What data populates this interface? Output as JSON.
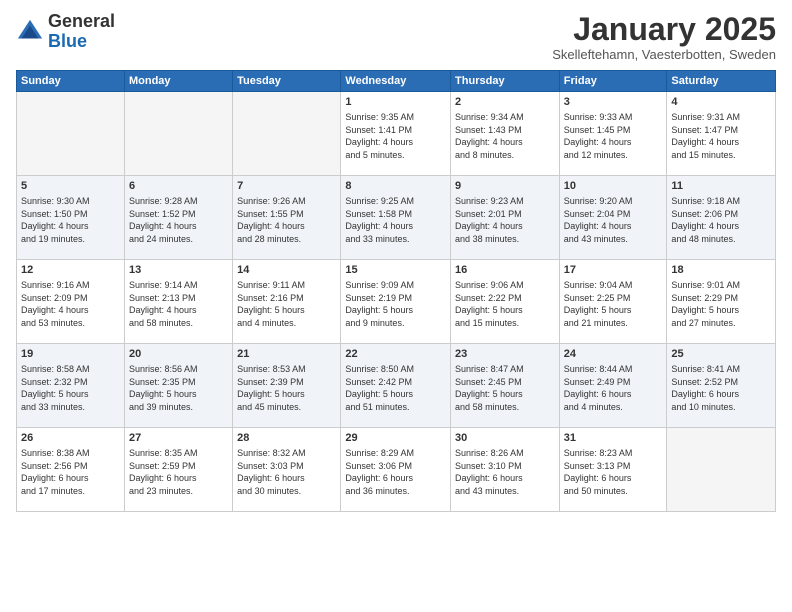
{
  "logo": {
    "general": "General",
    "blue": "Blue"
  },
  "header": {
    "title": "January 2025",
    "location": "Skelleftehamn, Vaesterbotten, Sweden"
  },
  "weekdays": [
    "Sunday",
    "Monday",
    "Tuesday",
    "Wednesday",
    "Thursday",
    "Friday",
    "Saturday"
  ],
  "weeks": [
    [
      {
        "day": "",
        "info": ""
      },
      {
        "day": "",
        "info": ""
      },
      {
        "day": "",
        "info": ""
      },
      {
        "day": "1",
        "info": "Sunrise: 9:35 AM\nSunset: 1:41 PM\nDaylight: 4 hours\nand 5 minutes."
      },
      {
        "day": "2",
        "info": "Sunrise: 9:34 AM\nSunset: 1:43 PM\nDaylight: 4 hours\nand 8 minutes."
      },
      {
        "day": "3",
        "info": "Sunrise: 9:33 AM\nSunset: 1:45 PM\nDaylight: 4 hours\nand 12 minutes."
      },
      {
        "day": "4",
        "info": "Sunrise: 9:31 AM\nSunset: 1:47 PM\nDaylight: 4 hours\nand 15 minutes."
      }
    ],
    [
      {
        "day": "5",
        "info": "Sunrise: 9:30 AM\nSunset: 1:50 PM\nDaylight: 4 hours\nand 19 minutes."
      },
      {
        "day": "6",
        "info": "Sunrise: 9:28 AM\nSunset: 1:52 PM\nDaylight: 4 hours\nand 24 minutes."
      },
      {
        "day": "7",
        "info": "Sunrise: 9:26 AM\nSunset: 1:55 PM\nDaylight: 4 hours\nand 28 minutes."
      },
      {
        "day": "8",
        "info": "Sunrise: 9:25 AM\nSunset: 1:58 PM\nDaylight: 4 hours\nand 33 minutes."
      },
      {
        "day": "9",
        "info": "Sunrise: 9:23 AM\nSunset: 2:01 PM\nDaylight: 4 hours\nand 38 minutes."
      },
      {
        "day": "10",
        "info": "Sunrise: 9:20 AM\nSunset: 2:04 PM\nDaylight: 4 hours\nand 43 minutes."
      },
      {
        "day": "11",
        "info": "Sunrise: 9:18 AM\nSunset: 2:06 PM\nDaylight: 4 hours\nand 48 minutes."
      }
    ],
    [
      {
        "day": "12",
        "info": "Sunrise: 9:16 AM\nSunset: 2:09 PM\nDaylight: 4 hours\nand 53 minutes."
      },
      {
        "day": "13",
        "info": "Sunrise: 9:14 AM\nSunset: 2:13 PM\nDaylight: 4 hours\nand 58 minutes."
      },
      {
        "day": "14",
        "info": "Sunrise: 9:11 AM\nSunset: 2:16 PM\nDaylight: 5 hours\nand 4 minutes."
      },
      {
        "day": "15",
        "info": "Sunrise: 9:09 AM\nSunset: 2:19 PM\nDaylight: 5 hours\nand 9 minutes."
      },
      {
        "day": "16",
        "info": "Sunrise: 9:06 AM\nSunset: 2:22 PM\nDaylight: 5 hours\nand 15 minutes."
      },
      {
        "day": "17",
        "info": "Sunrise: 9:04 AM\nSunset: 2:25 PM\nDaylight: 5 hours\nand 21 minutes."
      },
      {
        "day": "18",
        "info": "Sunrise: 9:01 AM\nSunset: 2:29 PM\nDaylight: 5 hours\nand 27 minutes."
      }
    ],
    [
      {
        "day": "19",
        "info": "Sunrise: 8:58 AM\nSunset: 2:32 PM\nDaylight: 5 hours\nand 33 minutes."
      },
      {
        "day": "20",
        "info": "Sunrise: 8:56 AM\nSunset: 2:35 PM\nDaylight: 5 hours\nand 39 minutes."
      },
      {
        "day": "21",
        "info": "Sunrise: 8:53 AM\nSunset: 2:39 PM\nDaylight: 5 hours\nand 45 minutes."
      },
      {
        "day": "22",
        "info": "Sunrise: 8:50 AM\nSunset: 2:42 PM\nDaylight: 5 hours\nand 51 minutes."
      },
      {
        "day": "23",
        "info": "Sunrise: 8:47 AM\nSunset: 2:45 PM\nDaylight: 5 hours\nand 58 minutes."
      },
      {
        "day": "24",
        "info": "Sunrise: 8:44 AM\nSunset: 2:49 PM\nDaylight: 6 hours\nand 4 minutes."
      },
      {
        "day": "25",
        "info": "Sunrise: 8:41 AM\nSunset: 2:52 PM\nDaylight: 6 hours\nand 10 minutes."
      }
    ],
    [
      {
        "day": "26",
        "info": "Sunrise: 8:38 AM\nSunset: 2:56 PM\nDaylight: 6 hours\nand 17 minutes."
      },
      {
        "day": "27",
        "info": "Sunrise: 8:35 AM\nSunset: 2:59 PM\nDaylight: 6 hours\nand 23 minutes."
      },
      {
        "day": "28",
        "info": "Sunrise: 8:32 AM\nSunset: 3:03 PM\nDaylight: 6 hours\nand 30 minutes."
      },
      {
        "day": "29",
        "info": "Sunrise: 8:29 AM\nSunset: 3:06 PM\nDaylight: 6 hours\nand 36 minutes."
      },
      {
        "day": "30",
        "info": "Sunrise: 8:26 AM\nSunset: 3:10 PM\nDaylight: 6 hours\nand 43 minutes."
      },
      {
        "day": "31",
        "info": "Sunrise: 8:23 AM\nSunset: 3:13 PM\nDaylight: 6 hours\nand 50 minutes."
      },
      {
        "day": "",
        "info": ""
      }
    ]
  ]
}
